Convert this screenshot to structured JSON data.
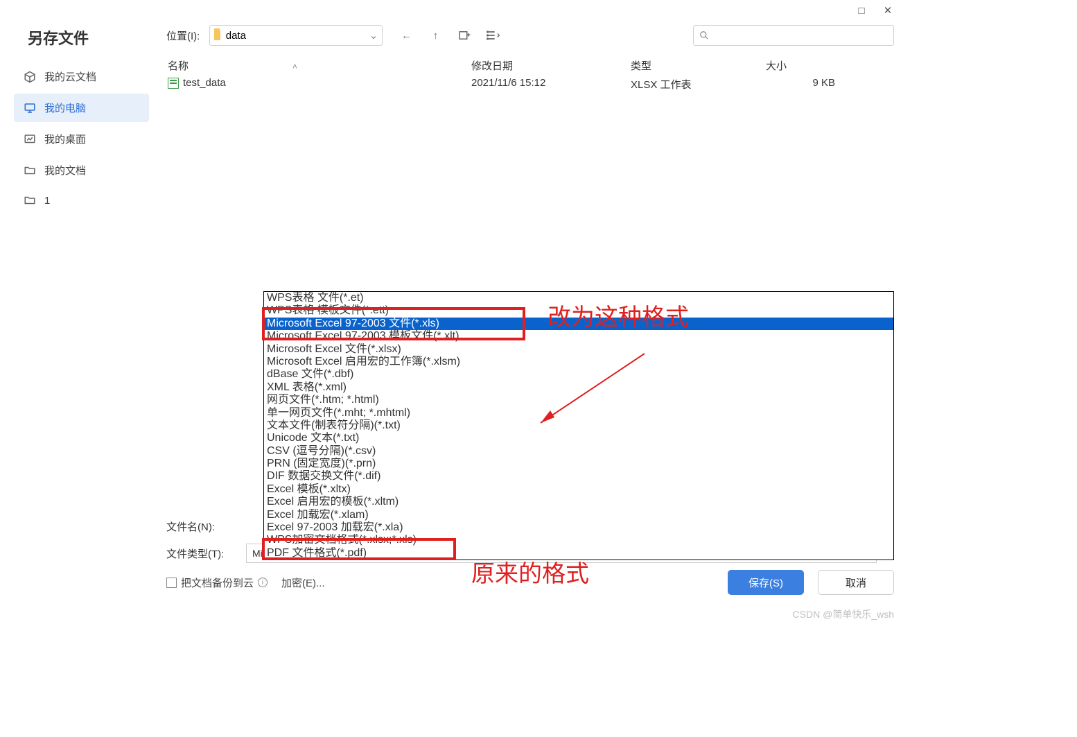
{
  "title": "另存文件",
  "winctrl": {
    "max": "□",
    "close": "✕"
  },
  "sidebar": {
    "items": [
      {
        "label": "我的云文档"
      },
      {
        "label": "我的电脑"
      },
      {
        "label": "我的桌面"
      },
      {
        "label": "我的文档"
      },
      {
        "label": "1"
      }
    ]
  },
  "location": {
    "label": "位置(I):",
    "value": "data"
  },
  "columns": {
    "name": "名称",
    "date": "修改日期",
    "type": "类型",
    "size": "大小"
  },
  "files": [
    {
      "name": "test_data",
      "date": "2021/11/6 15:12",
      "type": "XLSX 工作表",
      "size": "9 KB"
    }
  ],
  "dropdown": {
    "items": [
      "WPS表格 文件(*.et)",
      "WPS表格 模板文件(*.ett)",
      "Microsoft Excel 97-2003 文件(*.xls)",
      "Microsoft Excel 97-2003 模板文件(*.xlt)",
      "Microsoft Excel 文件(*.xlsx)",
      "Microsoft Excel 启用宏的工作簿(*.xlsm)",
      "dBase 文件(*.dbf)",
      "XML 表格(*.xml)",
      "网页文件(*.htm; *.html)",
      "单一网页文件(*.mht; *.mhtml)",
      "文本文件(制表符分隔)(*.txt)",
      "Unicode 文本(*.txt)",
      "CSV (逗号分隔)(*.csv)",
      "PRN (固定宽度)(*.prn)",
      "DIF 数据交换文件(*.dif)",
      "Excel 模板(*.xltx)",
      "Excel 启用宏的模板(*.xltm)",
      "Excel 加载宏(*.xlam)",
      "Excel 97-2003 加载宏(*.xla)",
      "WPS加密文档格式(*.xlsx;*.xls)",
      "PDF 文件格式(*.pdf)"
    ],
    "selected_index": 2
  },
  "filename_label": "文件名(N):",
  "filetype_label": "文件类型(T):",
  "filetype_value": "Microsoft Excel 文件(*.xlsx)",
  "backup_label": "把文档备份到云",
  "encrypt_label": "加密(E)...",
  "save_label": "保存(S)",
  "cancel_label": "取消",
  "annotations": {
    "top": "改为这种格式",
    "bottom": "原来的格式"
  },
  "watermark": "CSDN @简单快乐_wsh"
}
